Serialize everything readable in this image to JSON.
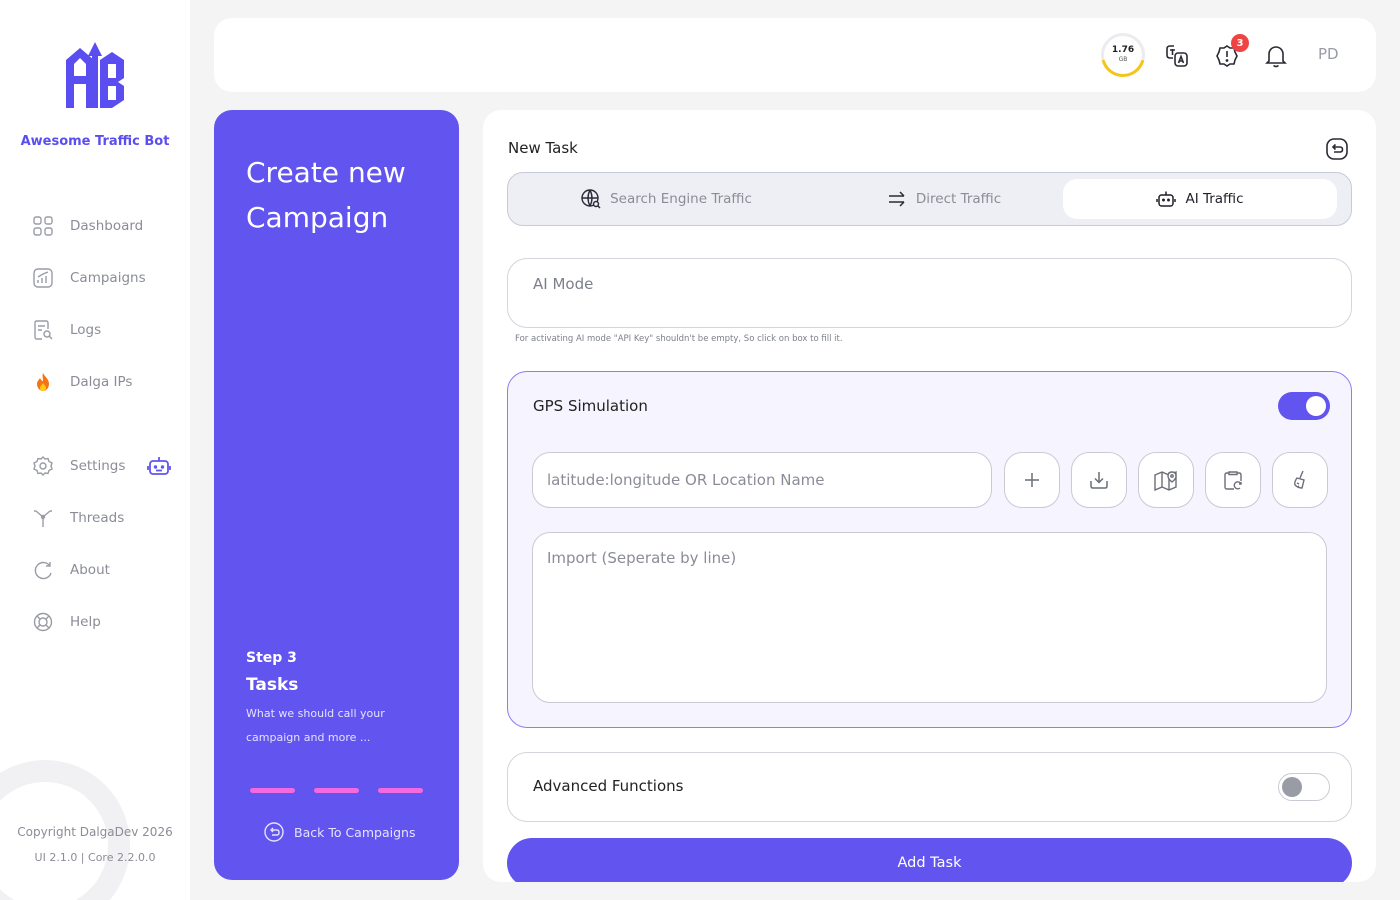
{
  "brand": {
    "name": "Awesome Traffic Bot",
    "logo_text": "ATB"
  },
  "sidebar": {
    "items": [
      {
        "label": "Dashboard",
        "icon": "grid-icon"
      },
      {
        "label": "Campaigns",
        "icon": "chart-icon"
      },
      {
        "label": "Logs",
        "icon": "document-search-icon"
      },
      {
        "label": "Dalga IPs",
        "icon": "fire-icon"
      },
      {
        "label": "Settings",
        "icon": "gear-icon"
      },
      {
        "label": "Threads",
        "icon": "branch-icon"
      },
      {
        "label": "About",
        "icon": "refresh-icon"
      },
      {
        "label": "Help",
        "icon": "lifebuoy-icon"
      }
    ],
    "copyright": "Copyright DalgaDev 2026",
    "version": "UI 2.1.0 | Core 2.2.0.0"
  },
  "topbar": {
    "storage_value": "1.76",
    "storage_unit": "GB",
    "storage_fraction": 0.4,
    "alerts_count": "3",
    "user_initials": "PD"
  },
  "step_panel": {
    "title": "Create new Campaign",
    "step_number": "Step 3",
    "step_name": "Tasks",
    "step_description": "What we should call your campaign and more ...",
    "back_label": "Back To Campaigns"
  },
  "task": {
    "title": "New Task",
    "tabs": [
      {
        "label": "Search Engine Traffic",
        "active": false
      },
      {
        "label": "Direct Traffic",
        "active": false
      },
      {
        "label": "AI Traffic",
        "active": true
      }
    ],
    "ai_mode_placeholder": "AI Mode",
    "ai_mode_hint": "For activating AI mode \"API Key\" shouldn't be empty, So click on box to fill it.",
    "gps": {
      "title": "GPS Simulation",
      "enabled": true,
      "location_placeholder": "latitude:longitude OR Location Name",
      "import_placeholder": "Import (Seperate by line)"
    },
    "advanced": {
      "title": "Advanced Functions",
      "enabled": false
    },
    "add_button": "Add Task"
  },
  "colors": {
    "accent": "#6254ef",
    "pink": "#f26ae0",
    "badge": "#ef4444",
    "storage_ring": "#f5c518"
  }
}
